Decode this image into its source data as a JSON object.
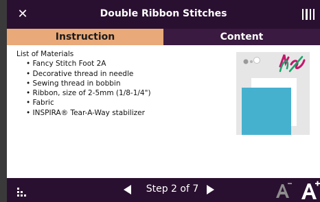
{
  "window": {
    "title": "Double Ribbon Stitches",
    "close_icon": "close-icon",
    "menu_icon": "menu-icon"
  },
  "tabs": [
    {
      "label": "Instruction",
      "active": true
    },
    {
      "label": "Content",
      "active": false
    }
  ],
  "materials": {
    "heading": "List of Materials",
    "items": [
      "Fancy Stitch Foot 2A",
      "Decorative thread in needle",
      "Sewing thread in bobbin",
      "Ribbon, size of 2-5mm (1/8-1/4\")",
      "Fabric",
      "INSPIRA® Tear-A-Way stabilizer"
    ]
  },
  "illustration": {
    "description_icon": "machine-screen-illustration"
  },
  "footer": {
    "step_label": "Step 2 of 7",
    "grid_icon": "grid-icon",
    "prev_icon": "previous-arrow-icon",
    "next_icon": "next-arrow-icon",
    "font_smaller_icon": "font-decrease-icon",
    "font_larger_icon": "font-increase-icon"
  },
  "colors": {
    "titlebar": "#2a1030",
    "tab_active": "#e9a978",
    "tab_inactive": "#3a1a40",
    "accent_blue": "#46b1cf",
    "accent_pink": "#c6166c",
    "accent_green": "#1aa46a"
  }
}
